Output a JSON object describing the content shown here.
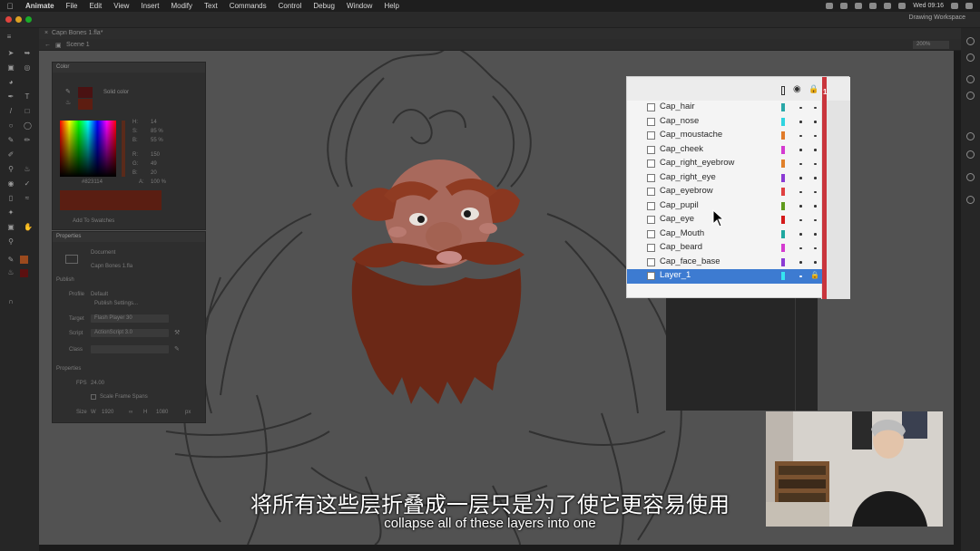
{
  "menubar": {
    "app": "Animate",
    "items": [
      "File",
      "Edit",
      "View",
      "Insert",
      "Modify",
      "Text",
      "Commands",
      "Control",
      "Debug",
      "Window",
      "Help"
    ],
    "clock": "Wed 09:16"
  },
  "app": {
    "workspace": "Drawing Workspace",
    "doc_tab": "Capn Bones 1.fla*",
    "scene": "Scene 1",
    "zoom": "200%"
  },
  "color_panel": {
    "title": "Color",
    "fill_type": "Solid color",
    "h_label": "H:",
    "h_value": "14",
    "s_label": "S:",
    "s_value": "85 %",
    "b_label": "B:",
    "b_value": "55 %",
    "r_label": "R:",
    "r_value": "150",
    "g_label": "G:",
    "g_value": "49",
    "bl_label": "B:",
    "bl_value": "20",
    "hex": "#823114",
    "alpha_label": "A:",
    "alpha_value": "100 %",
    "add_swatches": "Add To Swatches"
  },
  "properties_panel": {
    "title": "Properties",
    "doc_label": "Document",
    "doc_name": "Capn Bones 1.fla",
    "publish_heading": "Publish",
    "profile_label": "Profile",
    "profile_value": "Default",
    "publish_settings": "Publish Settings...",
    "target_label": "Target",
    "target_value": "Flash Player 30",
    "script_label": "Script",
    "script_value": "ActionScript 3.0",
    "class_label": "Class",
    "properties_heading": "Properties",
    "fps_label": "FPS",
    "fps_value": "24.00",
    "scale_spans": "Scale Frame Spans",
    "size_label": "Size",
    "w_label": "W",
    "w_value": "1920",
    "h_label": "H",
    "h_value": "1080",
    "px": "px"
  },
  "timeline": {
    "frame_number": "1",
    "layers": [
      {
        "name": "Cap_hair",
        "color": "#2aa8a8"
      },
      {
        "name": "Cap_nose",
        "color": "#2fd4e0"
      },
      {
        "name": "Cap_moustache",
        "color": "#e07b2a"
      },
      {
        "name": "Cap_cheek",
        "color": "#d43ad0"
      },
      {
        "name": "Cap_right_eyebrow",
        "color": "#e0802a"
      },
      {
        "name": "Cap_right_eye",
        "color": "#8b3ad4"
      },
      {
        "name": "Cap_eyebrow",
        "color": "#e04040"
      },
      {
        "name": "Cap_pupil",
        "color": "#5f9a1c"
      },
      {
        "name": "Cap_eye",
        "color": "#d41a1a"
      },
      {
        "name": "Cap_Mouth",
        "color": "#1fa8a0"
      },
      {
        "name": "Cap_beard",
        "color": "#d43ad0"
      },
      {
        "name": "Cap_face_base",
        "color": "#8b3ad4"
      },
      {
        "name": "Layer_1",
        "color": "#35e4f0"
      }
    ],
    "selected_index": 12
  },
  "subtitles": {
    "chinese": "将所有这些层折叠成一层只是为了使它更容易使用",
    "english": "collapse all of these layers into one"
  }
}
